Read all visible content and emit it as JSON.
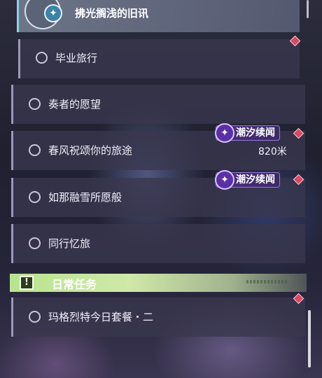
{
  "header": {
    "title": "拂光搁浅的旧讯",
    "icon": "compass-star-icon"
  },
  "quests": [
    {
      "label": "毕业旅行"
    },
    {
      "label": "奏者的愿望"
    },
    {
      "label": "春风祝颂你的旅途",
      "distance": "820米",
      "tag": "潮汐续闻"
    },
    {
      "label": "如那融雪所愿般",
      "tag": "潮汐续闻"
    },
    {
      "label": "同行忆旅"
    }
  ],
  "daily": {
    "title": "日常任务",
    "quests": [
      {
        "label": "玛格烈特今日套餐・二"
      }
    ]
  },
  "colors": {
    "tracked_marker": "#d84a64",
    "tag_background": "#4a2f7e",
    "daily_bar": "#b8e48e",
    "header_accent": "#8fd0ea"
  }
}
